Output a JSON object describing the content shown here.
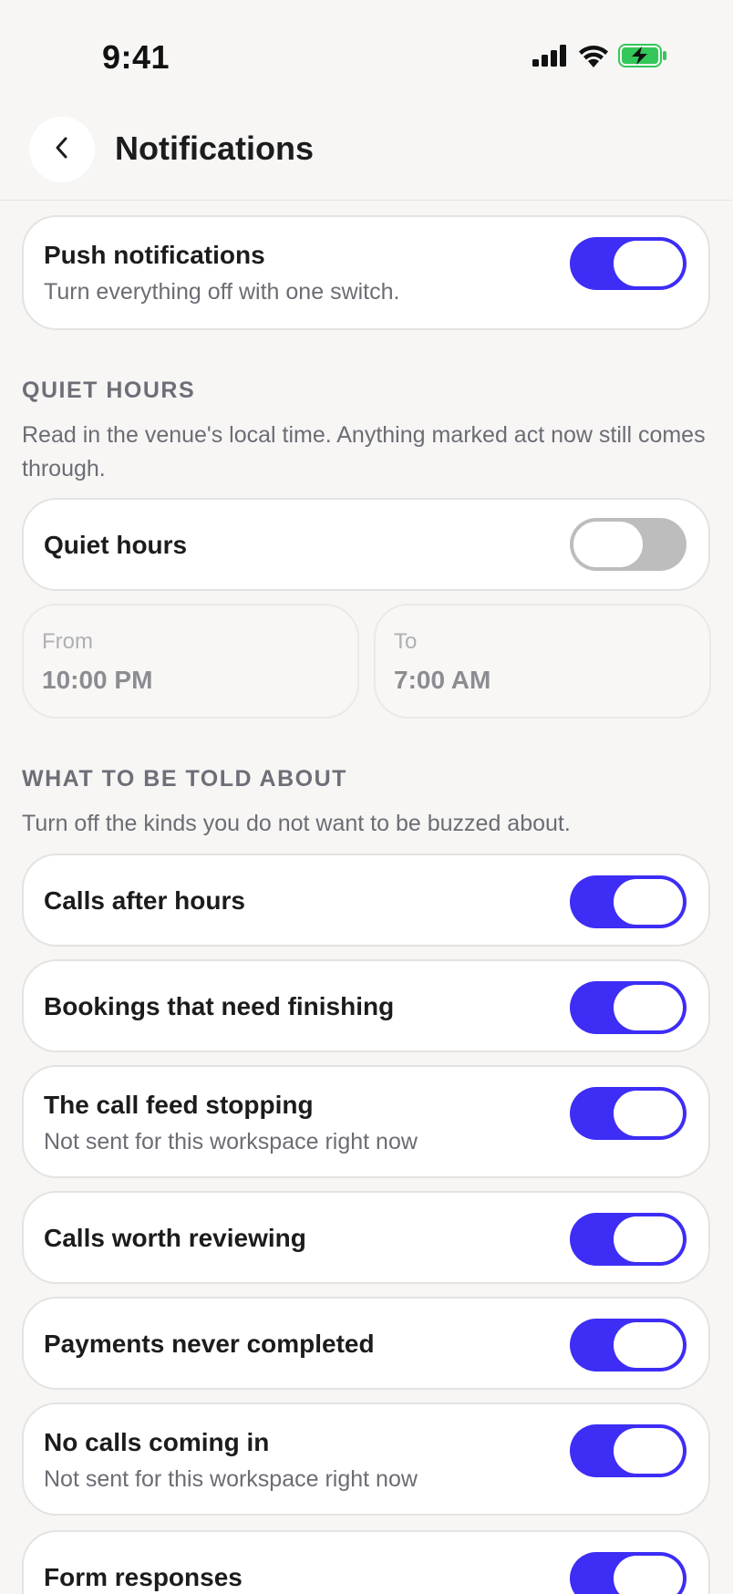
{
  "status_bar": {
    "time": "9:41"
  },
  "header": {
    "title": "Notifications"
  },
  "push": {
    "title": "Push notifications",
    "subtitle": "Turn everything off with one switch.",
    "on": true
  },
  "quiet_hours": {
    "section_label": "QUIET HOURS",
    "description": "Read in the venue's local time. Anything marked act now still comes through.",
    "toggle_label": "Quiet hours",
    "on": false,
    "from_label": "From",
    "from_value": "10:00 PM",
    "to_label": "To",
    "to_value": "7:00 AM"
  },
  "told_about": {
    "section_label": "WHAT TO BE TOLD ABOUT",
    "description": "Turn off the kinds you do not want to be buzzed about.",
    "items": [
      {
        "title": "Calls after hours",
        "subtitle": "",
        "on": true
      },
      {
        "title": "Bookings that need finishing",
        "subtitle": "",
        "on": true
      },
      {
        "title": "The call feed stopping",
        "subtitle": "Not sent for this workspace right now",
        "on": true
      },
      {
        "title": "Calls worth reviewing",
        "subtitle": "",
        "on": true
      },
      {
        "title": "Payments never completed",
        "subtitle": "",
        "on": true
      },
      {
        "title": "No calls coming in",
        "subtitle": "Not sent for this workspace right now",
        "on": true
      },
      {
        "title": "Form responses",
        "subtitle": "",
        "on": true
      }
    ]
  },
  "colors": {
    "accent": "#3d2df5",
    "toggle_off": "#bdbdbd",
    "battery": "#34c759"
  }
}
